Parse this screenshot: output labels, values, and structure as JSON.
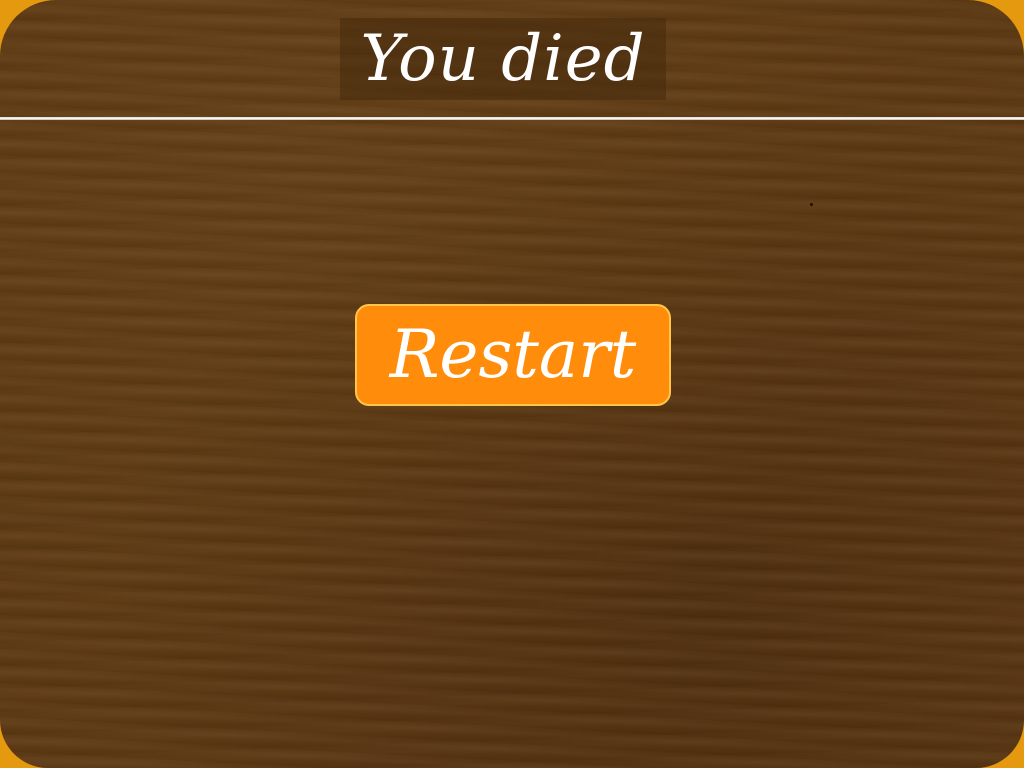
{
  "screen": {
    "title": "You died",
    "restart_label": "Restart"
  },
  "colors": {
    "frame": "#e5990f",
    "panel": "#5e3a14",
    "button": "#ff8c0a",
    "button_border": "#ffc74a",
    "text": "#ffffff"
  }
}
